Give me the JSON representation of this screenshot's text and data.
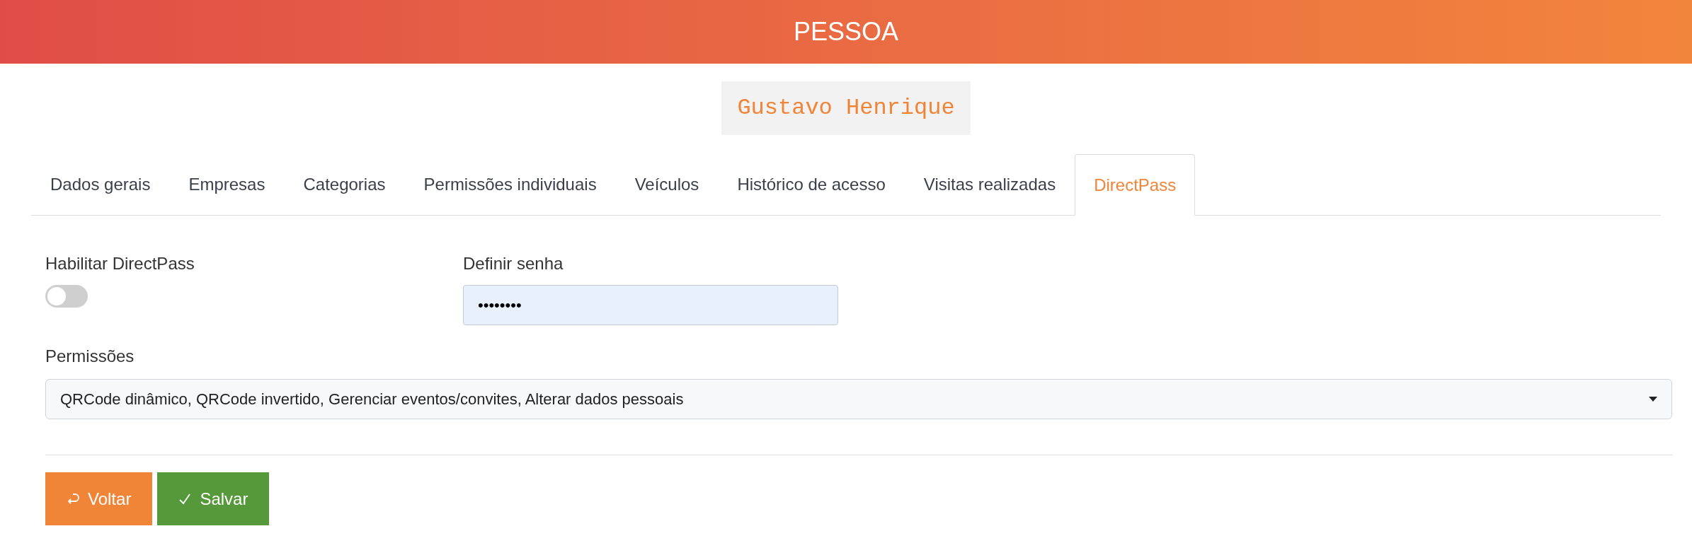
{
  "header": {
    "title": "PESSOA"
  },
  "person_name": "Gustavo Henrique",
  "tabs": [
    {
      "label": "Dados gerais",
      "selected": false
    },
    {
      "label": "Empresas",
      "selected": false
    },
    {
      "label": "Categorias",
      "selected": false
    },
    {
      "label": "Permissões individuais",
      "selected": false
    },
    {
      "label": "Veículos",
      "selected": false
    },
    {
      "label": "Histórico de acesso",
      "selected": false
    },
    {
      "label": "Visitas realizadas",
      "selected": false
    },
    {
      "label": "DirectPass",
      "selected": true
    }
  ],
  "form": {
    "enable": {
      "label": "Habilitar DirectPass",
      "on": false
    },
    "password": {
      "label": "Definir senha",
      "value": "••••••••"
    },
    "permissions": {
      "label": "Permissões",
      "value": "QRCode dinâmico, QRCode invertido, Gerenciar eventos/convites, Alterar dados pessoais"
    }
  },
  "buttons": [
    {
      "kind": "back",
      "label": "Voltar"
    },
    {
      "kind": "save",
      "label": "Salvar"
    }
  ]
}
